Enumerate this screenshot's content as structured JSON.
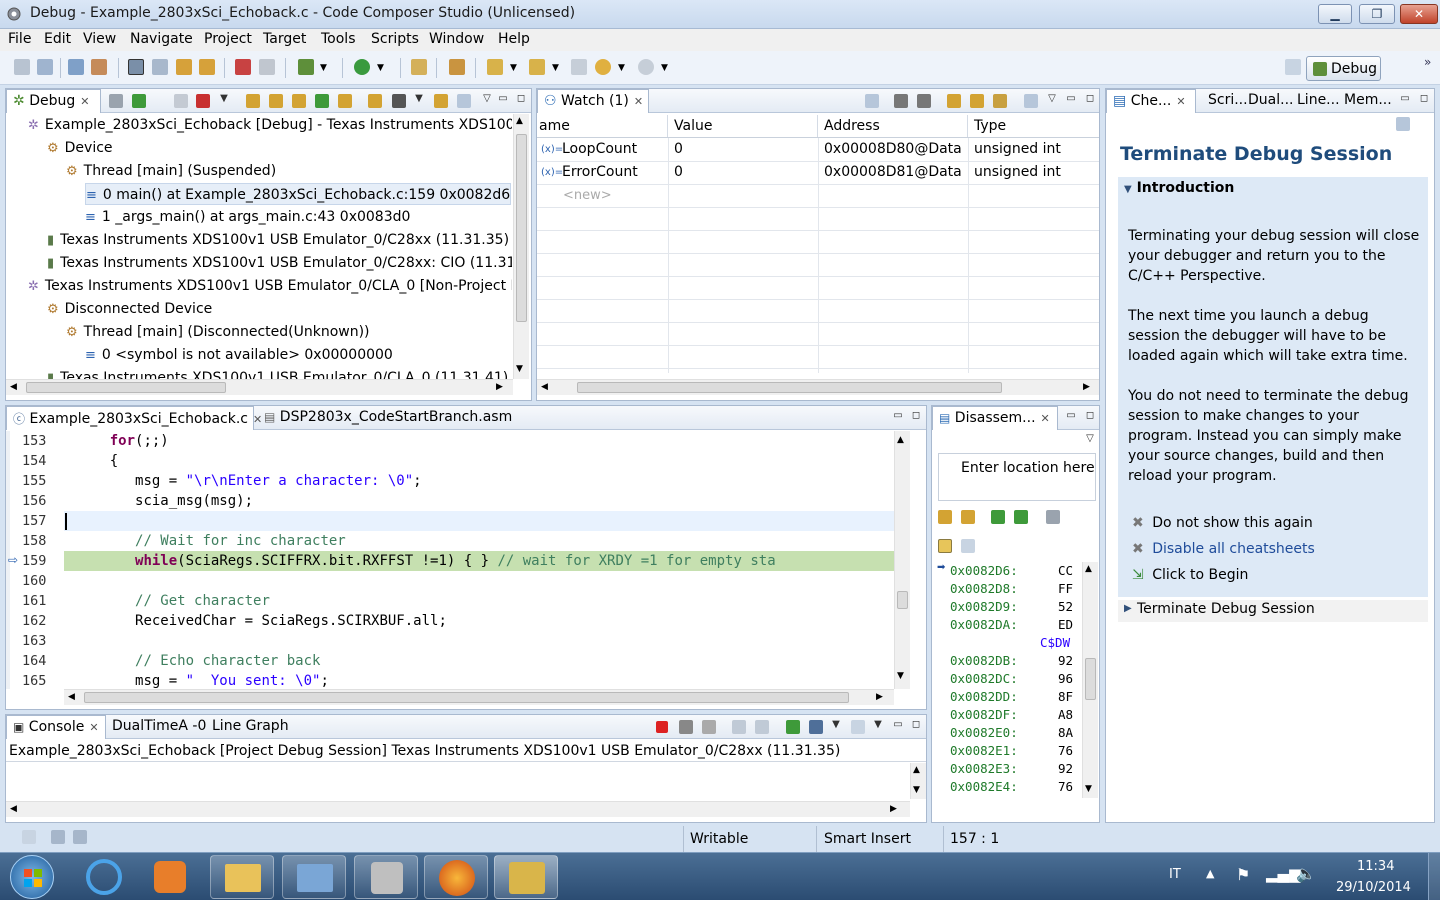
{
  "window": {
    "title": "Debug - Example_2803xSci_Echoback.c - Code Composer Studio (Unlicensed)",
    "min": "▁",
    "max": "❐",
    "close": "✕"
  },
  "menu": [
    "File",
    "Edit",
    "View",
    "Navigate",
    "Project",
    "Target",
    "Tools",
    "Scripts",
    "Window",
    "Help"
  ],
  "perspective": {
    "label": "Debug"
  },
  "debug_view": {
    "tab": "Debug",
    "items": [
      {
        "label": "Example_2803xSci_Echoback [Debug] - Texas Instruments XDS100v1 U",
        "icon": "debug-session-icon",
        "indent": 0
      },
      {
        "label": "Device",
        "icon": "device-icon",
        "indent": 1
      },
      {
        "label": "Thread [main] (Suspended)",
        "icon": "thread-icon",
        "indent": 2
      },
      {
        "label": "0 main() at Example_2803xSci_Echoback.c:159 0x0082d6",
        "icon": "stack-frame-icon",
        "indent": 3
      },
      {
        "label": "1 _args_main() at args_main.c:43 0x0083d0",
        "icon": "stack-frame-icon",
        "indent": 3
      },
      {
        "label": "Texas Instruments XDS100v1 USB Emulator_0/C28xx (11.31.35)",
        "icon": "emulator-icon",
        "indent": 1
      },
      {
        "label": "Texas Instruments XDS100v1 USB Emulator_0/C28xx: CIO (11.31.35)",
        "icon": "emulator-icon",
        "indent": 1
      },
      {
        "label": "Texas Instruments XDS100v1 USB Emulator_0/CLA_0 [Non-Project Del",
        "icon": "debug-session-icon",
        "indent": 0
      },
      {
        "label": "Disconnected Device",
        "icon": "device-icon",
        "indent": 1
      },
      {
        "label": "Thread [main] (Disconnected(Unknown))",
        "icon": "thread-icon",
        "indent": 2
      },
      {
        "label": "0 <symbol is not available> 0x00000000",
        "icon": "stack-frame-icon",
        "indent": 3
      },
      {
        "label": "Texas Instruments XDS100v1 USB Emulator_0/CLA_0 (11.31.41)",
        "icon": "emulator-icon",
        "indent": 1
      }
    ]
  },
  "watch": {
    "tab": "Watch (1)",
    "headers": [
      "ame",
      "Value",
      "Address",
      "Type"
    ],
    "rows": [
      {
        "name": "LoopCount",
        "value": "0",
        "address": "0x00008D80@Data",
        "type": "unsigned int"
      },
      {
        "name": "ErrorCount",
        "value": "0",
        "address": "0x00008D81@Data",
        "type": "unsigned int"
      }
    ],
    "new_placeholder": "<new>"
  },
  "cheatsheet": {
    "tabs": [
      "Che...",
      "Scri...",
      "Dual...",
      "Line...",
      "Mem..."
    ],
    "title": "Terminate Debug Session",
    "section": "Introduction",
    "paragraphs": [
      "Terminating your debug session will close your debugger and return you to the C/C++ Perspective.",
      "The next time you launch a debug session the debugger will have to be loaded again which will take extra time.",
      "You do not need to terminate the debug session to make changes to your program. Instead you can simply make your source changes, build and then reload your program."
    ],
    "actions": [
      "Do not show this again",
      "Disable all cheatsheets",
      "Click to Begin"
    ],
    "step": "Terminate Debug Session"
  },
  "editor": {
    "tabs": [
      "Example_2803xSci_Echoback.c",
      "DSP2803x_CodeStartBranch.asm"
    ],
    "lines": [
      {
        "n": "153",
        "code": [
          [
            "kw",
            "for"
          ],
          [
            "",
            "(;;)"
          ]
        ],
        "indent": "    "
      },
      {
        "n": "154",
        "code": [
          [
            "",
            "{"
          ]
        ],
        "indent": "    "
      },
      {
        "n": "155",
        "code": [
          [
            "",
            "msg = "
          ],
          [
            "str",
            "\"\\r\\nEnter a character: \\0\""
          ],
          [
            "",
            ";"
          ]
        ],
        "indent": "       "
      },
      {
        "n": "156",
        "code": [
          [
            "",
            "scia_msg(msg);"
          ]
        ],
        "indent": "       "
      },
      {
        "n": "157",
        "code": [
          [
            "",
            ""
          ]
        ],
        "indent": ""
      },
      {
        "n": "158",
        "code": [
          [
            "cm",
            "// Wait for inc character"
          ]
        ],
        "indent": "       "
      },
      {
        "n": "159",
        "code": [
          [
            "kw",
            "while"
          ],
          [
            "",
            "(SciaRegs.SCIFFRX.bit.RXFFST !=1) { } "
          ],
          [
            "cm",
            "// wait for XRDY =1 for empty sta"
          ]
        ],
        "indent": "       "
      },
      {
        "n": "160",
        "code": [
          [
            "",
            ""
          ]
        ],
        "indent": ""
      },
      {
        "n": "161",
        "code": [
          [
            "cm",
            "// Get character"
          ]
        ],
        "indent": "       "
      },
      {
        "n": "162",
        "code": [
          [
            "",
            "ReceivedChar = SciaRegs.SCIRXBUF.all;"
          ]
        ],
        "indent": "       "
      },
      {
        "n": "163",
        "code": [
          [
            "",
            ""
          ]
        ],
        "indent": ""
      },
      {
        "n": "164",
        "code": [
          [
            "cm",
            "// Echo character back"
          ]
        ],
        "indent": "       "
      },
      {
        "n": "165",
        "code": [
          [
            "",
            "msg = "
          ],
          [
            "str",
            "\"  You sent: \\0\""
          ],
          [
            "",
            ";"
          ]
        ],
        "indent": "       "
      }
    ]
  },
  "disassembly": {
    "tab": "Disassem...",
    "location_placeholder": "Enter location here",
    "rows": [
      {
        "addr": "0x0082D6:",
        "val": "CC"
      },
      {
        "addr": "0x0082D8:",
        "val": "FF"
      },
      {
        "addr": "0x0082D9:",
        "val": "52"
      },
      {
        "addr": "0x0082DA:",
        "val": "ED"
      },
      {
        "addr": "",
        "val": "C$DW"
      },
      {
        "addr": "0x0082DB:",
        "val": "92"
      },
      {
        "addr": "0x0082DC:",
        "val": "96"
      },
      {
        "addr": "0x0082DD:",
        "val": "8F"
      },
      {
        "addr": "0x0082DF:",
        "val": "A8"
      },
      {
        "addr": "0x0082E0:",
        "val": "8A"
      },
      {
        "addr": "0x0082E1:",
        "val": "76"
      },
      {
        "addr": "0x0082E3:",
        "val": "92"
      },
      {
        "addr": "0x0082E4:",
        "val": "76"
      }
    ]
  },
  "console": {
    "tabs": [
      "Console",
      "DualTimeA -0",
      "Line Graph"
    ],
    "session": "Example_2803xSci_Echoback [Project Debug Session] Texas Instruments XDS100v1 USB Emulator_0/C28xx (11.31.35)"
  },
  "statusbar": {
    "mode": "Writable",
    "insert": "Smart Insert",
    "position": "157 : 1"
  },
  "taskbar": {
    "lang": "IT",
    "time": "11:34",
    "date": "29/10/2014"
  }
}
